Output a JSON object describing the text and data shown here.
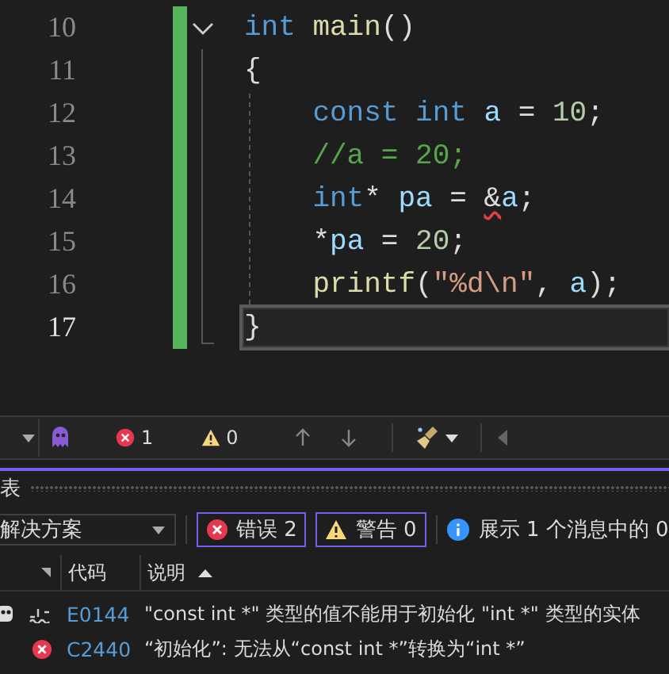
{
  "editor": {
    "lines": [
      {
        "number": "10",
        "fold": true,
        "current": false,
        "tokens": [
          {
            "kind": "keyword",
            "text": "int"
          },
          {
            "kind": "function",
            "text": " main"
          },
          {
            "kind": "plain",
            "text": "()"
          }
        ]
      },
      {
        "number": "11",
        "fold": false,
        "current": false,
        "tokens": [
          {
            "kind": "plain",
            "text": "{"
          }
        ]
      },
      {
        "number": "12",
        "fold": false,
        "current": false,
        "tokens": [
          {
            "kind": "keyword",
            "text": "    const int"
          },
          {
            "kind": "variable",
            "text": " a"
          },
          {
            "kind": "plain",
            "text": " = "
          },
          {
            "kind": "number",
            "text": "10"
          },
          {
            "kind": "plain",
            "text": ";"
          }
        ]
      },
      {
        "number": "13",
        "fold": false,
        "current": false,
        "tokens": [
          {
            "kind": "comment",
            "text": "    //a = 20;"
          }
        ]
      },
      {
        "number": "14",
        "fold": false,
        "current": false,
        "tokens": [
          {
            "kind": "keyword",
            "text": "    int"
          },
          {
            "kind": "plain",
            "text": "* "
          },
          {
            "kind": "variable",
            "text": "pa"
          },
          {
            "kind": "plain",
            "text": " = "
          },
          {
            "kind": "error",
            "text": "&"
          },
          {
            "kind": "variable",
            "text": "a"
          },
          {
            "kind": "plain",
            "text": ";"
          }
        ]
      },
      {
        "number": "15",
        "fold": false,
        "current": false,
        "tokens": [
          {
            "kind": "plain",
            "text": "    *"
          },
          {
            "kind": "variable",
            "text": "pa"
          },
          {
            "kind": "plain",
            "text": " = "
          },
          {
            "kind": "number",
            "text": "20"
          },
          {
            "kind": "plain",
            "text": ";"
          }
        ]
      },
      {
        "number": "16",
        "fold": false,
        "current": false,
        "tokens": [
          {
            "kind": "function",
            "text": "    printf"
          },
          {
            "kind": "plain",
            "text": "("
          },
          {
            "kind": "string",
            "text": "″%d\\n″"
          },
          {
            "kind": "plain",
            "text": ", "
          },
          {
            "kind": "variable",
            "text": "a"
          },
          {
            "kind": "plain",
            "text": ");"
          }
        ]
      },
      {
        "number": "17",
        "fold": false,
        "current": true,
        "tokens": [
          {
            "kind": "plain",
            "text": "}"
          }
        ]
      }
    ]
  },
  "status_bar": {
    "errors": "1",
    "warnings": "0"
  },
  "error_list": {
    "title": "表",
    "scope": "解决方案",
    "filters": [
      {
        "kind": "error",
        "label": "错误 2",
        "selected": true
      },
      {
        "kind": "warning",
        "label": "警告 0",
        "selected": true
      }
    ],
    "info": "展示 1 个消息中的 0",
    "columns": [
      "代码",
      "说明"
    ],
    "rows": [
      {
        "kind": "intellisense",
        "code": "E0144",
        "description": "\"const int *\" 类型的值不能用于初始化 \"int *\" 类型的实体"
      },
      {
        "kind": "build",
        "code": "C2440",
        "description": "“初始化”: 无法从“const int *”转换为“int *”"
      }
    ]
  }
}
